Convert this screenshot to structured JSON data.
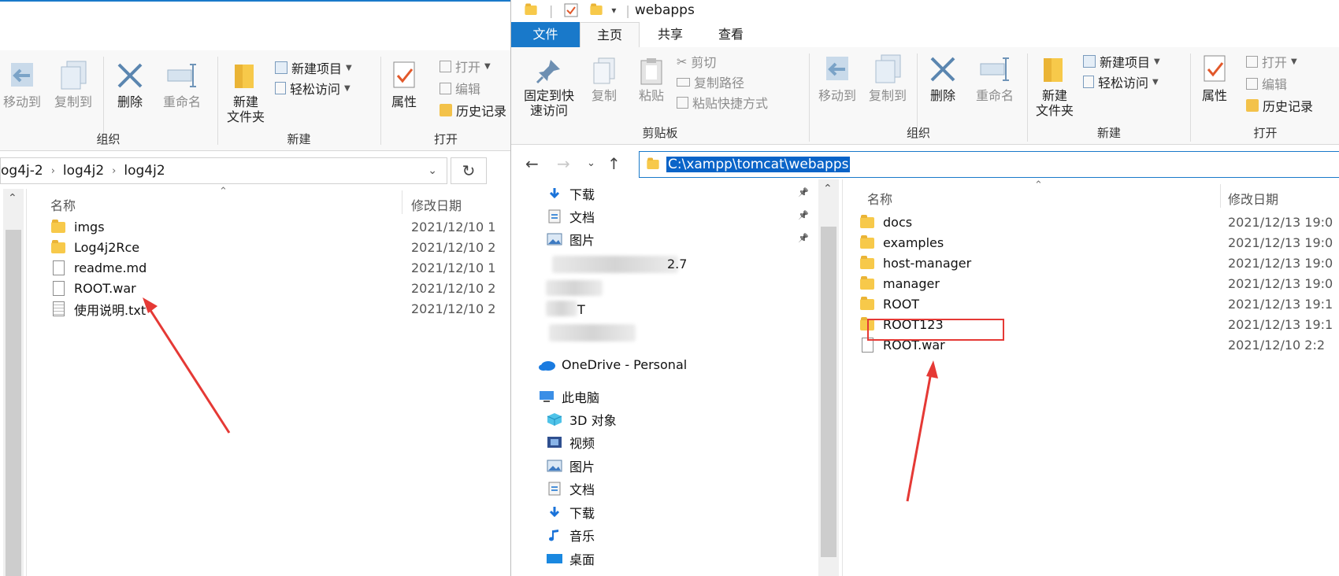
{
  "left": {
    "ribbon": {
      "organize": {
        "label": "组织",
        "move_to": "移动到",
        "copy_to": "复制到",
        "delete": "删除",
        "rename": "重命名"
      },
      "new": {
        "label": "新建",
        "new_folder_line1": "新建",
        "new_folder_line2": "文件夹",
        "new_item": "新建项目",
        "easy_access": "轻松访问"
      },
      "open": {
        "label": "打开",
        "properties": "属性",
        "open_btn": "打开",
        "edit": "编辑",
        "history": "历史记录"
      }
    },
    "address": {
      "crumbs": [
        "og4j-2",
        "log4j2",
        "log4j2"
      ]
    },
    "columns": {
      "name": "名称",
      "modified": "修改日期"
    },
    "files": [
      {
        "name": "imgs",
        "type": "folder",
        "date": "2021/12/10 1"
      },
      {
        "name": "Log4j2Rce",
        "type": "folder",
        "date": "2021/12/10 2"
      },
      {
        "name": "readme.md",
        "type": "md",
        "date": "2021/12/10 1"
      },
      {
        "name": "ROOT.war",
        "type": "file",
        "date": "2021/12/10 2"
      },
      {
        "name": "使用说明.txt",
        "type": "txt",
        "date": "2021/12/10 2"
      }
    ]
  },
  "right": {
    "title": "webapps",
    "tabs": {
      "file": "文件",
      "home": "主页",
      "share": "共享",
      "view": "查看"
    },
    "ribbon": {
      "clipboard": {
        "label": "剪贴板",
        "pin_line1": "固定到快",
        "pin_line2": "速访问",
        "copy": "复制",
        "paste": "粘贴",
        "cut": "剪切",
        "copy_path": "复制路径",
        "paste_shortcut": "粘贴快捷方式"
      },
      "organize": {
        "label": "组织",
        "move_to": "移动到",
        "copy_to": "复制到",
        "delete": "删除",
        "rename": "重命名"
      },
      "new": {
        "label": "新建",
        "new_folder_line1": "新建",
        "new_folder_line2": "文件夹",
        "new_item": "新建项目",
        "easy_access": "轻松访问"
      },
      "open": {
        "label": "打开",
        "properties": "属性",
        "open_btn": "打开",
        "edit": "编辑",
        "history": "历史记录"
      }
    },
    "address": {
      "path": "C:\\xampp\\tomcat\\webapps"
    },
    "nav": {
      "quick": [
        {
          "label": "下载",
          "icon": "download-icon"
        },
        {
          "label": "文档",
          "icon": "documents-icon"
        },
        {
          "label": "图片",
          "icon": "pictures-icon"
        }
      ],
      "partial_blurred": "2.7",
      "partial_blurred_2": "T",
      "onedrive": "OneDrive - Personal",
      "this_pc": "此电脑",
      "pc_items": [
        {
          "label": "3D 对象",
          "icon": "3d-objects-icon"
        },
        {
          "label": "视频",
          "icon": "videos-icon"
        },
        {
          "label": "图片",
          "icon": "pictures-icon"
        },
        {
          "label": "文档",
          "icon": "documents-icon"
        },
        {
          "label": "下载",
          "icon": "download-icon"
        },
        {
          "label": "音乐",
          "icon": "music-icon"
        },
        {
          "label": "桌面",
          "icon": "desktop-icon"
        }
      ]
    },
    "columns": {
      "name": "名称",
      "modified": "修改日期"
    },
    "files": [
      {
        "name": "docs",
        "type": "folder",
        "date": "2021/12/13 19:0"
      },
      {
        "name": "examples",
        "type": "folder",
        "date": "2021/12/13 19:0"
      },
      {
        "name": "host-manager",
        "type": "folder",
        "date": "2021/12/13 19:0"
      },
      {
        "name": "manager",
        "type": "folder",
        "date": "2021/12/13 19:0"
      },
      {
        "name": "ROOT",
        "type": "folder",
        "date": "2021/12/13 19:1"
      },
      {
        "name": "ROOT123",
        "type": "folder",
        "date": "2021/12/13 19:1"
      },
      {
        "name": "ROOT.war",
        "type": "file",
        "date": "2021/12/10 2:2"
      }
    ]
  },
  "colors": {
    "accent": "#1979ca",
    "annotation": "#e53935",
    "folder": "#f7c94a"
  }
}
